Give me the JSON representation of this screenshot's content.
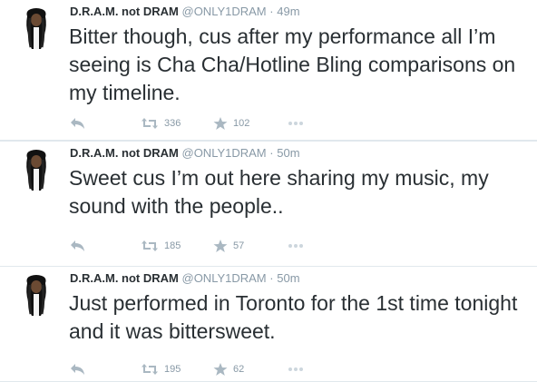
{
  "tweets": [
    {
      "name": "D.R.A.M. not DRAM",
      "handle": "@ONLY1DRAM",
      "separator": "·",
      "time": "49m",
      "text": "Bitter though, cus after my performance all I’m seeing is Cha Cha/Hotline Bling comparisons on my timeline.",
      "retweets": "336",
      "favorites": "102"
    },
    {
      "name": "D.R.A.M. not DRAM",
      "handle": "@ONLY1DRAM",
      "separator": "·",
      "time": "50m",
      "text": "Sweet cus I’m out here sharing my music, my sound with the people..",
      "retweets": "185",
      "favorites": "57"
    },
    {
      "name": "D.R.A.M. not DRAM",
      "handle": "@ONLY1DRAM",
      "separator": "·",
      "time": "50m",
      "text": "Just performed in Toronto for the 1st time tonight and it was bittersweet.",
      "retweets": "195",
      "favorites": "62"
    }
  ],
  "icons": {
    "reply": "reply-icon",
    "retweet": "retweet-icon",
    "favorite": "star-icon",
    "more": "more-dots-icon"
  },
  "colors": {
    "text": "#292f33",
    "muted": "#8899a6",
    "divider": "#e1e8ed"
  }
}
